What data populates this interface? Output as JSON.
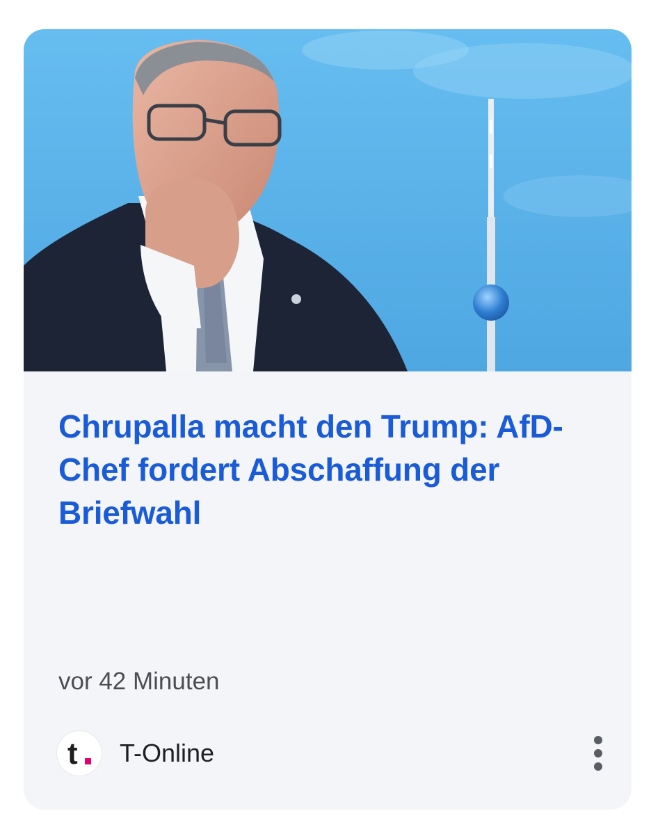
{
  "article": {
    "image_alt": "Man in a dark suit speaking in front of a blue sky with the Berlin TV tower",
    "headline": "Chrupalla macht den Trump: AfD-Chef fordert Abschaffung der Briefwahl",
    "timestamp": "vor 42 Minuten"
  },
  "publisher": {
    "name": "T-Online",
    "logo_letter": "t",
    "logo_dot_color": "#e5006e"
  },
  "actions": {
    "more_icon": "more-vertical-icon",
    "more_label": "More options"
  },
  "colors": {
    "headline": "#1a5bd7",
    "card_background": "#f4f5f8",
    "sky": "#5fb6ea"
  }
}
